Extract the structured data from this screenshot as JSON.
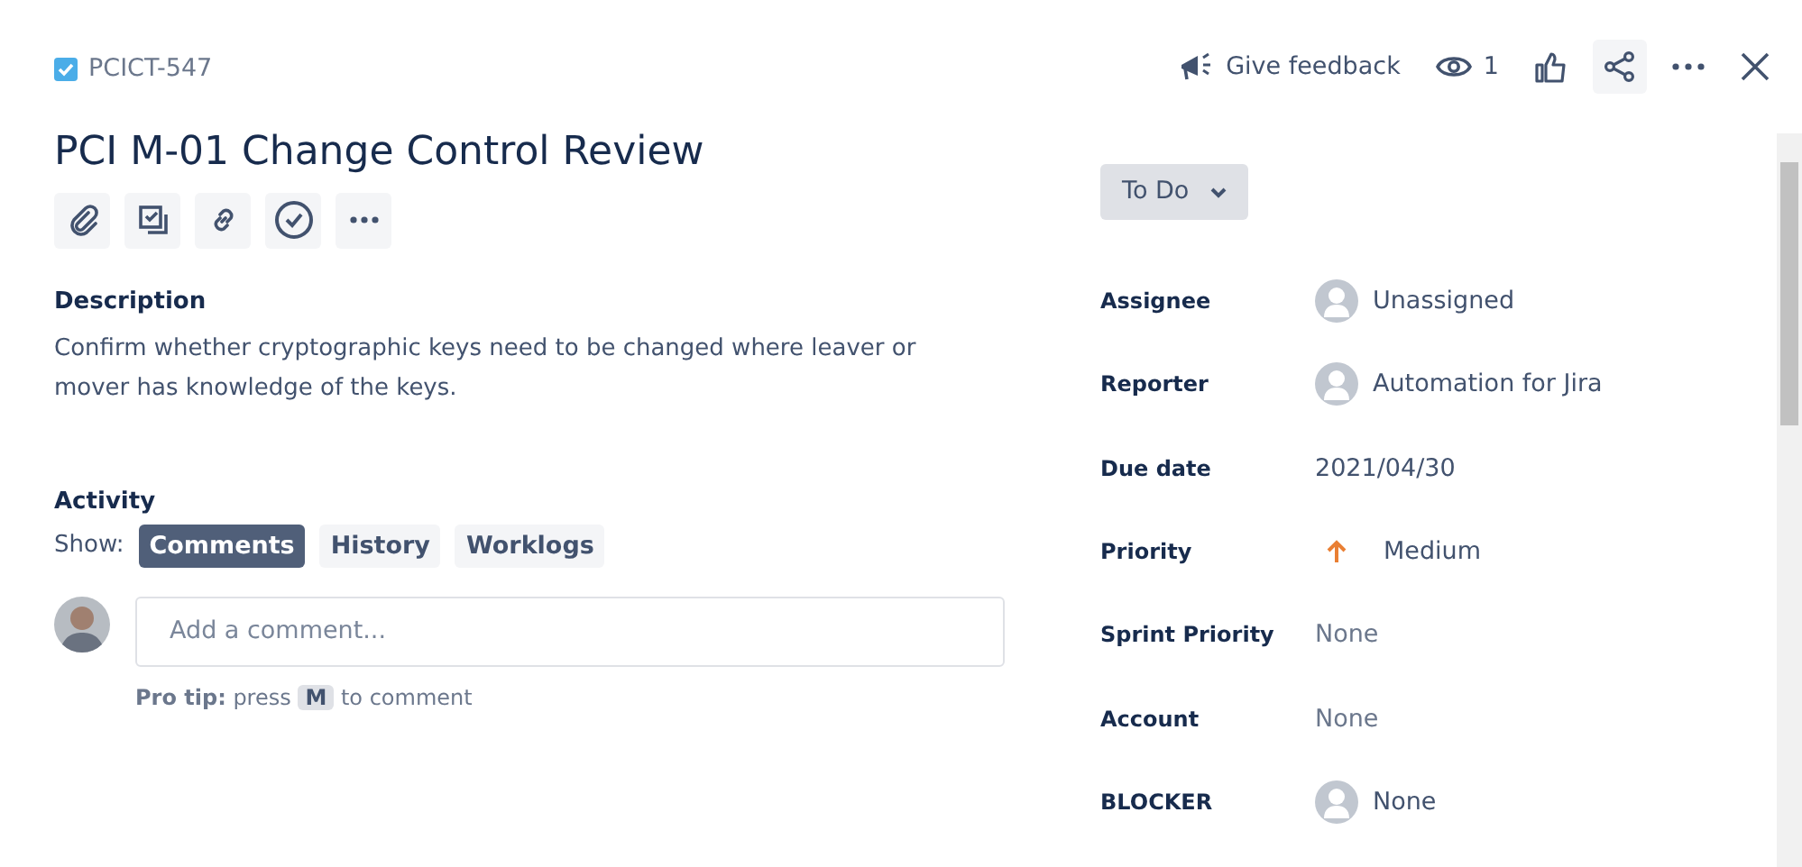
{
  "issue_key": "PCICT-547",
  "header_actions": {
    "feedback": "Give feedback",
    "watchers": "1"
  },
  "title": "PCI M-01 Change Control Review",
  "description": {
    "heading": "Description",
    "text": "Confirm whether cryptographic keys need to be changed where leaver or mover has knowledge of the keys."
  },
  "activity": {
    "heading": "Activity",
    "show_label": "Show:",
    "filters": [
      {
        "label": "Comments",
        "selected": true
      },
      {
        "label": "History",
        "selected": false
      },
      {
        "label": "Worklogs",
        "selected": false
      }
    ],
    "comment": {
      "placeholder": "Add a comment..."
    },
    "pro_tip": {
      "lead": "Pro tip:",
      "before": "press",
      "key": "M",
      "after": "to comment"
    }
  },
  "status": "To Do",
  "fields": [
    {
      "label": "Assignee",
      "value": "Unassigned",
      "kind": "user"
    },
    {
      "label": "Reporter",
      "value": "Automation for Jira",
      "kind": "user"
    },
    {
      "label": "Due date",
      "value": "2021/04/30",
      "kind": "text"
    },
    {
      "label": "Priority",
      "value": "Medium",
      "kind": "priority"
    },
    {
      "label": "Sprint Priority",
      "value": "None",
      "kind": "empty"
    },
    {
      "label": "Account",
      "value": "None",
      "kind": "empty"
    },
    {
      "label": "BLOCKER",
      "value": "None",
      "kind": "user"
    }
  ]
}
